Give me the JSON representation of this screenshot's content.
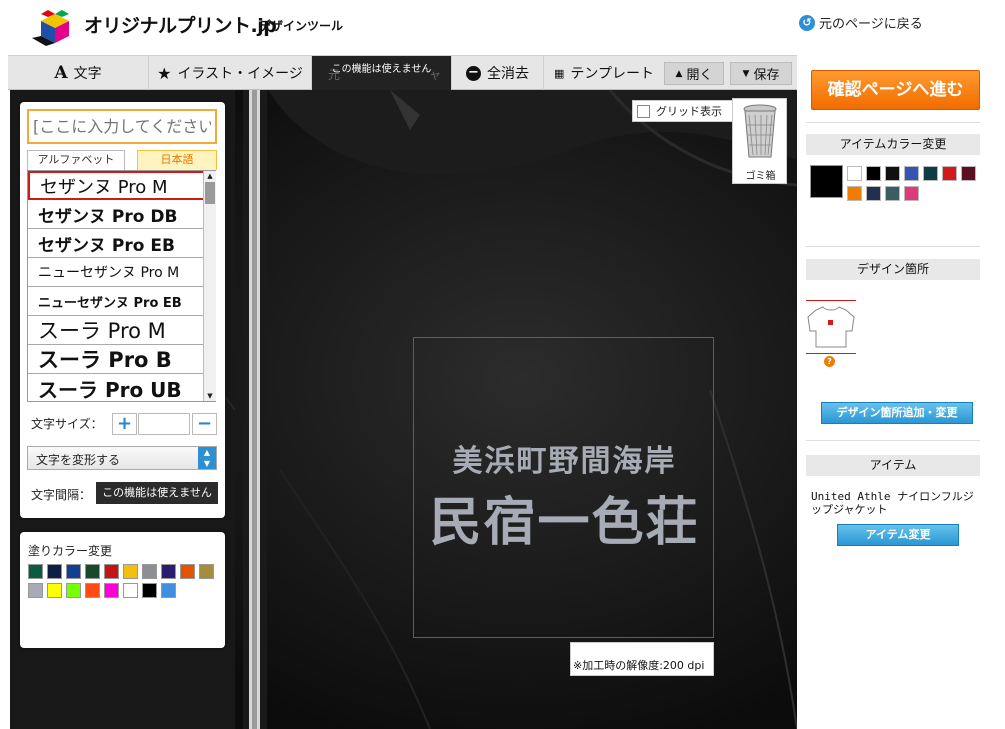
{
  "header": {
    "logo_text": "オリジナルプリント.jp",
    "logo_sub": "デザインツール",
    "back_link": "元のページに戻る"
  },
  "toolbar": {
    "text_tab": "文字",
    "illust_tab": "イラスト・イメージ",
    "undo_disabled": "この機能は使えません",
    "undo_ghost_left": "元",
    "undo_ghost_right": "ャ",
    "clear_tab": "全消去",
    "template_tab": "テンプレート",
    "open_btn": "開く",
    "save_btn": "保存"
  },
  "canvas": {
    "grid_label": "グリッド表示",
    "trash_label": "ゴミ箱",
    "design_line1": "美浜町野間海岸",
    "design_line2": "民宿一色荘",
    "resolution_note": "※加工時の解像度:200 dpi"
  },
  "text_panel": {
    "input_placeholder": "[ここに入力してください]",
    "tab_alphabet": "アルファベット",
    "tab_japanese": "日本語",
    "fonts": [
      "セザンヌ Pro M",
      "セザンヌ Pro DB",
      "セザンヌ Pro EB",
      "ニューセザンヌ Pro M",
      "ニューセザンヌ Pro EB",
      "スーラ Pro M",
      "スーラ Pro B",
      "スーラ Pro UB"
    ],
    "selected_font_index": 0,
    "size_label": "文字サイズ：",
    "size_plus": "+",
    "size_minus": "−",
    "transform_label": "文字を変形する",
    "spacing_label": "文字間隔：",
    "spacing_disabled": "この機能は使えません"
  },
  "fill_panel": {
    "title": "塗りカラー変更",
    "colors": [
      "#0b5b3e",
      "#0f1e45",
      "#123f8f",
      "#174a28",
      "#c21515",
      "#f2be10",
      "#8d8f95",
      "#2a1c6e",
      "#e25400",
      "#a58d3c",
      "#a7abb5",
      "#ffff00",
      "#76ff00",
      "#ff4a14",
      "#ff00d4",
      "#ffffff",
      "#000000",
      "#3f8ee0"
    ]
  },
  "sidebar": {
    "confirm_button": "確認ページへ進む",
    "item_color_title": "アイテムカラー変更",
    "selected_item_color": "#000000",
    "item_colors": [
      "#ffffff",
      "#000000",
      "#101010",
      "#3555b0",
      "#0f3b45",
      "#d11b1b",
      "#5a1020",
      "#f07c00",
      "#223050",
      "#3b5d62",
      "#e03a7a"
    ],
    "location_title": "デザイン箇所",
    "location_help": "?",
    "location_button": "デザイン箇所追加・変更",
    "item_title": "アイテム",
    "item_name": "United Athle ナイロンフルジップジャケット",
    "item_button": "アイテム変更"
  }
}
